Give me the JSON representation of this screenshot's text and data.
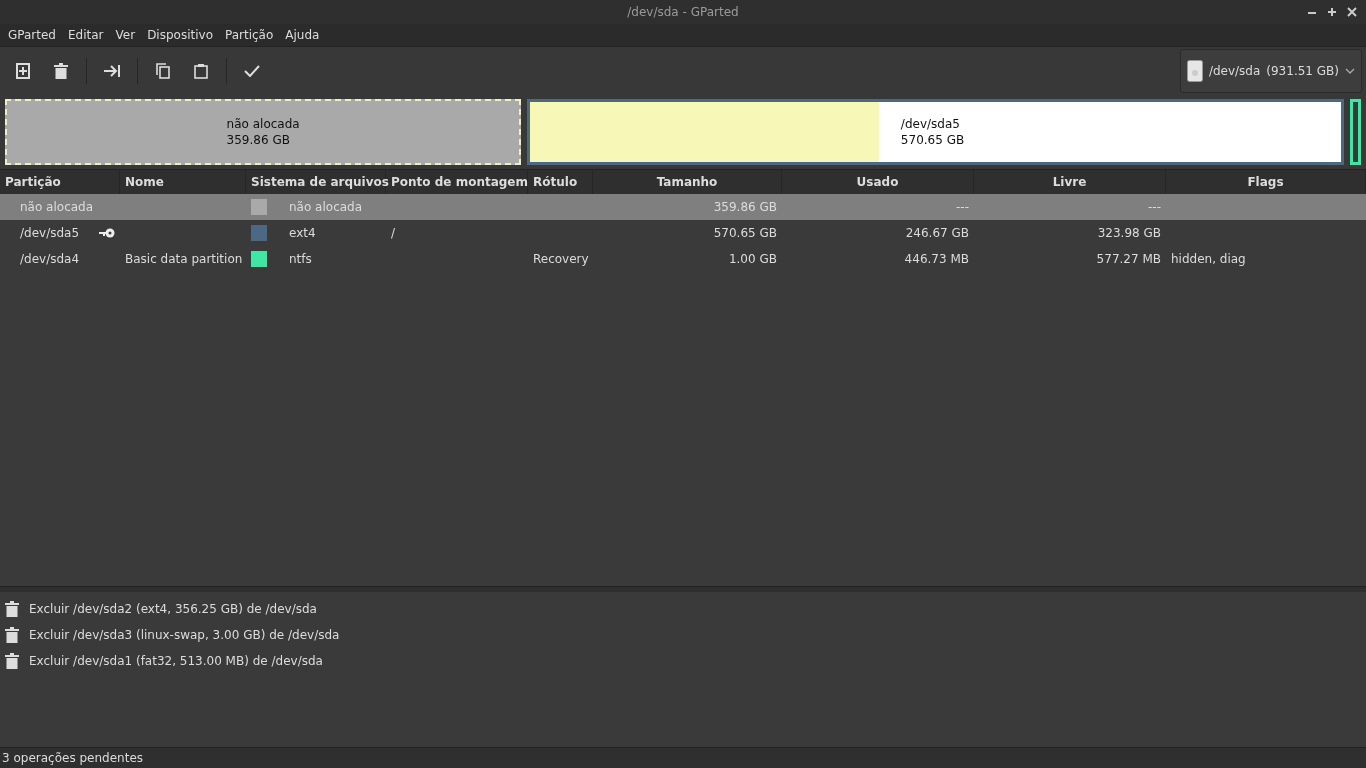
{
  "window": {
    "title": "/dev/sda - GParted"
  },
  "menu": [
    "GParted",
    "Editar",
    "Ver",
    "Dispositivo",
    "Partição",
    "Ajuda"
  ],
  "device": {
    "name": "/dev/sda",
    "size": "(931.51 GB)"
  },
  "disk_map": [
    {
      "kind": "unallocated",
      "name": "não alocada",
      "size": "359.86 GB",
      "color": "#a9a9a9"
    },
    {
      "kind": "partition",
      "name": "/dev/sda5",
      "size": "570.65 GB",
      "color": "#4b6983",
      "level": 0.43
    },
    {
      "kind": "partition",
      "color": "#3ee8a4"
    }
  ],
  "table": {
    "columns": [
      "Partição",
      "Nome",
      "Sistema de arquivos",
      "Ponto de montagem",
      "Rótulo",
      "Tamanho",
      "Usado",
      "Livre",
      "Flags"
    ],
    "rows": [
      {
        "selected": true,
        "mounted": false,
        "partition": "não alocada",
        "name": "",
        "color": "#a9a9a9",
        "filesystem": "não alocada",
        "mountpoint": "",
        "label": "",
        "size": "359.86 GB",
        "used": "---",
        "free": "---",
        "flags": ""
      },
      {
        "selected": false,
        "mounted": true,
        "partition": "/dev/sda5",
        "name": "",
        "color": "#4b6983",
        "filesystem": "ext4",
        "mountpoint": "/",
        "label": "",
        "size": "570.65 GB",
        "used": "246.67 GB",
        "free": "323.98 GB",
        "flags": ""
      },
      {
        "selected": false,
        "mounted": false,
        "partition": "/dev/sda4",
        "name": "Basic data partition",
        "color": "#3ee8a4",
        "filesystem": "ntfs",
        "mountpoint": "",
        "label": "Recovery",
        "size": "1.00 GB",
        "used": "446.73 MB",
        "free": "577.27 MB",
        "flags": "hidden, diag"
      }
    ]
  },
  "operations": [
    "Excluir /dev/sda2 (ext4, 356.25 GB) de /dev/sda",
    "Excluir /dev/sda3 (linux-swap, 3.00 GB) de /dev/sda",
    "Excluir /dev/sda1 (fat32, 513.00 MB) de /dev/sda"
  ],
  "status_bar": "3 operações pendentes"
}
